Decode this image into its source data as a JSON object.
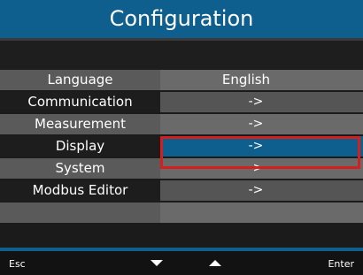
{
  "title": "Configuration",
  "menu": {
    "items": [
      {
        "label": "Language",
        "value": "English"
      },
      {
        "label": "Communication",
        "value": "->"
      },
      {
        "label": "Measurement",
        "value": "->"
      },
      {
        "label": "Display",
        "value": "->"
      },
      {
        "label": "System",
        "value": "->"
      },
      {
        "label": "Modbus Editor",
        "value": "->"
      }
    ],
    "selected_item": "Display"
  },
  "footer": {
    "esc_label": "Esc",
    "down_icon": "triangle-down-icon",
    "up_icon": "triangle-up-icon",
    "enter_label": "Enter"
  },
  "colors": {
    "accent": "#0f5f8e",
    "selection_outline": "#d51e1e",
    "background": "#1b1b1b"
  }
}
